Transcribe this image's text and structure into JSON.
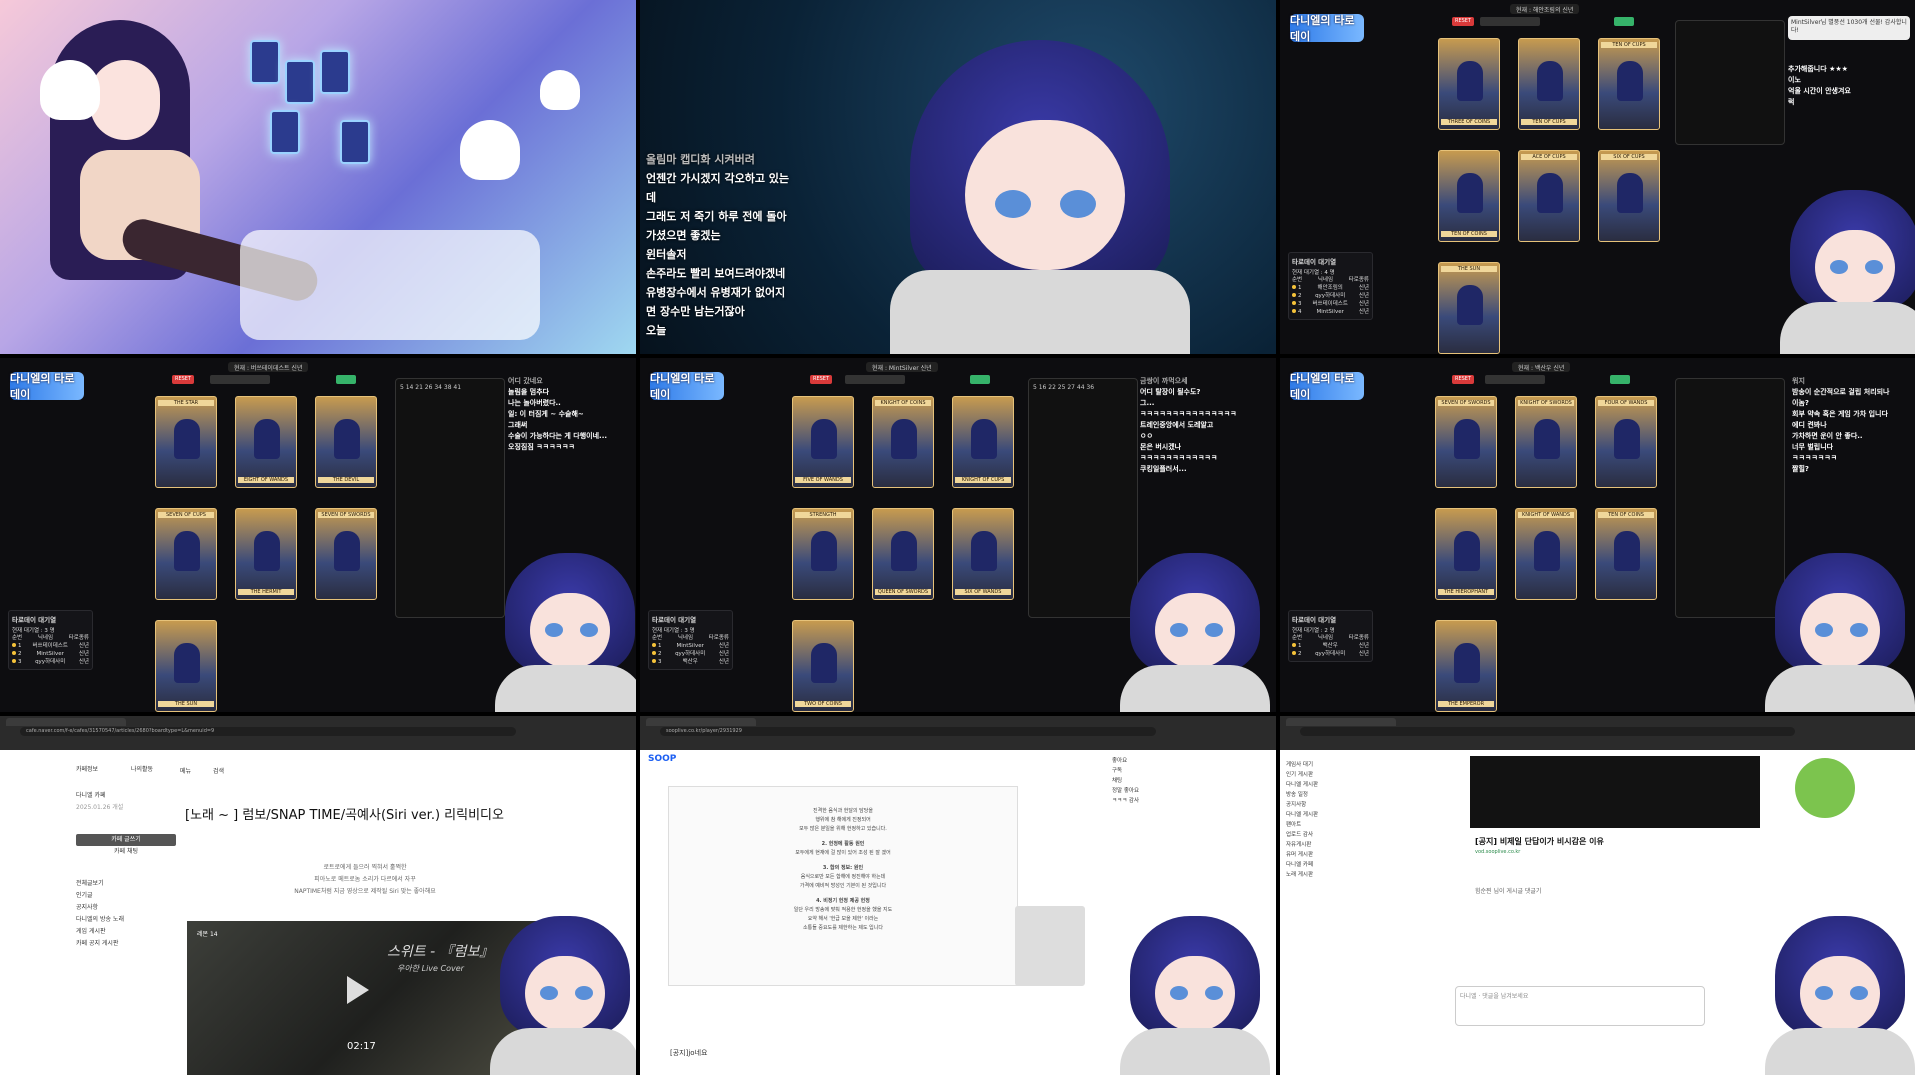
{
  "subtitles": [
    {
      "text": "올림마 캡디화 시켜버려",
      "dim": true
    },
    {
      "text": "언젠간 가시겠지 각오하고 있는"
    },
    {
      "text": "데"
    },
    {
      "text": "그래도 저 죽기 하루 전에 돌아"
    },
    {
      "text": "가셨으면 좋겠는"
    },
    {
      "text": "윈터솔저"
    },
    {
      "text": "손주라도 빨리 보여드려야겠네"
    },
    {
      "text": "유병장수에서 유병재가 없어지"
    },
    {
      "text": "면 장수만 남는거잖아"
    },
    {
      "text": "오늘"
    }
  ],
  "tarot": {
    "logo": "다니엘의 타로데이",
    "reset": "RESET",
    "queue_title": "타로데이 대기열",
    "columns": [
      "순번",
      "닉네임",
      "타로종류"
    ],
    "p1": {
      "topbar": "현재 : 해안조림의 신년",
      "queue_count": "현재 대기열 : 4 명",
      "queue": [
        {
          "n": "1",
          "name": "해안조림의",
          "type": "신년"
        },
        {
          "n": "2",
          "name": "qyy하데사미",
          "type": "신년"
        },
        {
          "n": "3",
          "name": "버쓰테이데스트",
          "type": "신년"
        },
        {
          "n": "4",
          "name": "MintSilver",
          "type": "신년"
        }
      ],
      "cards": [
        "THREE OF COINS",
        "TEN OF CUPS",
        "TEN OF CUPS",
        "TEN OF COINS",
        "ACE OF CUPS",
        "SIX OF CUPS",
        "THE SUN"
      ],
      "donation": "MintSilver님 별풍선 1030개 선물! 감사합니다!",
      "chat": [
        "추가해줍니다 ★★★",
        "이노",
        "억울 시간이 안생겨요",
        "럭"
      ]
    },
    "p2": {
      "topbar": "현재 : 버쓰테이데스트 신년",
      "queue_count": "현재 대기열 : 3 명",
      "queue": [
        {
          "n": "1",
          "name": "버쓰테이데스트",
          "type": "신년"
        },
        {
          "n": "2",
          "name": "MintSilver",
          "type": "신년"
        },
        {
          "n": "3",
          "name": "qyy하데사미",
          "type": "신년"
        }
      ],
      "cards": [
        "THE STAR",
        "EIGHT OF WANDS",
        "THE DEVIL",
        "SEVEN OF CUPS",
        "THE HERMIT",
        "SEVEN OF SWORDS",
        "THE SUN"
      ],
      "notes_head": "5 14 21 26 34 38 41",
      "chat": [
        "어디 갔네요",
        "놀림을 멈추다",
        "나는 놀아버렸다..",
        "일: 이 터짐게 ~ 수슬해~",
        "그래써",
        "수술이 가능하다는 게 다행이네...",
        "오징짐짐 ㅋㅋㅋㅋㅋㅋ"
      ]
    },
    "p3": {
      "topbar": "현재 : MintSilver 신년",
      "queue_count": "현재 대기열 : 3 명",
      "queue": [
        {
          "n": "1",
          "name": "MintSilver",
          "type": "신년"
        },
        {
          "n": "2",
          "name": "qyy하데사미",
          "type": "신년"
        },
        {
          "n": "3",
          "name": "백산우",
          "type": "신년"
        }
      ],
      "cards": [
        "FIVE OF WANDS",
        "KNIGHT OF COINS",
        "KNIGHT OF CUPS",
        "STRENGTH",
        "QUEEN OF SWORDS",
        "SIX OF WANDS",
        "TWO OF COINS"
      ],
      "notes_head": "5 16 22 25 27 44 36",
      "chat": [
        "금쌍이 까먹으세",
        "어디 탈장이 될수도?",
        "그...",
        "ㅋㅋㅋㅋㅋㅋㅋㅋㅋㅋㅋㅋㅋㅋㅋ",
        "트레인중앙에서 도레알고",
        "ㅇㅇ",
        "몬은 버시겠나",
        "ㅋㅋㅋㅋㅋㅋㅋㅋㅋㅋㅋㅋ",
        "쿠킹일플러서..."
      ]
    },
    "p4": {
      "topbar": "현재 : 백산우 신년",
      "queue_count": "현재 대기열 : 2 명",
      "queue": [
        {
          "n": "1",
          "name": "백산우",
          "type": "신년"
        },
        {
          "n": "2",
          "name": "qyy하데사미",
          "type": "신년"
        }
      ],
      "cards": [
        "SEVEN OF SWORDS",
        "KNIGHT OF SWORDS",
        "FOUR OF WANDS",
        "THE HIEROPHANT",
        "KNIGHT OF WANDS",
        "TEN OF COINS",
        "THE EMPEROR"
      ],
      "chat": [
        "워지",
        "밤송이 순간적으로 걸립 처리되나",
        "이놈?",
        "회부 약속 혹은 게임 가차 입니다",
        "에디 켠봐나",
        "가차하면 운이 안 좋다..",
        "너무 벌립니다",
        "ㅋㅋㅋㅋㅋㅋㅋ",
        "짤힐?"
      ]
    }
  },
  "cafe": {
    "title": "[노래 ~ ] 럼보/SNAP TIME/곡예사(Siri ver.) 리릭비디오",
    "body": [
      "로트로에게 들으러 찍혀서 훌쩍한",
      "피아노로 메트로놈 소리가 다르에서 자꾸",
      "NAPTIME처럼 지금 영상으로 제작될 Siri 맞는 좋아해요"
    ],
    "sidebar": [
      "카페정보",
      "나의활동",
      "다니엘 카페",
      "2025.01.26 개설",
      "카페 글쓰기",
      "카페 채팅",
      "전체글보기",
      "인기글",
      "공지사항",
      "다니엘의 방송 노래",
      "게임 게시판",
      "카페 공지 게시판"
    ],
    "video_head": "레몬 14",
    "video_title": "스위트 - 『럼보』",
    "video_sub": "우아한 Live Cover",
    "video_time": "02:17",
    "tabs": [
      "메뉴",
      "검색"
    ],
    "url": "cafe.naver.com/f-e/cafes/31570547/articles/2680?boardtype=L&menuid=9"
  },
  "soop": {
    "logo": "SOOP",
    "url": "sooplive.co.kr/player/2931929",
    "doc": [
      "진격한 음식과 헌달의 담당을",
      "행위에 참 해에게 진정되어",
      "모두 많은 분일을 위해 헌정하고 있습니다.",
      "2. 헌정에 활동 원인",
      "모두에게 현재에 걸 많이 있어 조성 된 잘 겠어",
      "3. 합의 정보: 원인",
      "음식으로만 모든 합해에 정진해야 하는데",
      "가격에 예비적 방성인 기본이 된 것입니다",
      "4. 비정기 헌정 제공 헌정",
      "일단 우리 방송에 맞춰 적용한 헌정을 했을 지도",
      "요약 해서 '헌급 모을 제한' 이라는",
      "소통들 중요도를 제한하는 제도 입니다"
    ],
    "bottom_title": "[공지]jo네요",
    "chat": [
      "좋아요",
      "구독",
      "채팅",
      "정말 좋아요",
      "ㅋㅋㅋ 감사"
    ]
  },
  "naver": {
    "title": "[공지] 비제일 단답이가 비시감은 이유",
    "url_text": "vod.sooplive.co.kr",
    "comment": "힘순찐 님이 게시글 댓글기",
    "reply_placeholder": "다니엘 · 댓글을 남겨보세요",
    "sidebar": [
      "게임사 대기",
      "인기 게시판",
      "다니엘 게시판",
      "방송 일정",
      "공지사항",
      "다니엘 게시판",
      "팬아트",
      "업로드 감사",
      "자유게시판",
      "유머 게시판",
      "다니엘 카페",
      "노래 게시판"
    ]
  }
}
